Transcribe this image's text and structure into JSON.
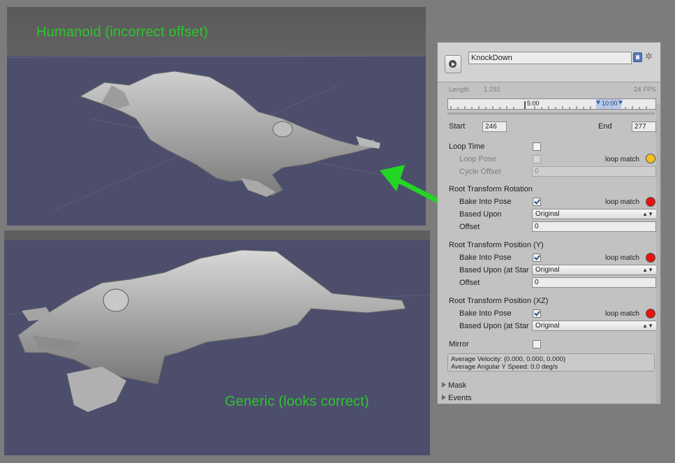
{
  "viewports": {
    "top_label": "Humanoid (incorrect offset)",
    "bottom_label": "Generic (looks correct)"
  },
  "colors": {
    "label_green": "#2ec52e",
    "sky_top": "#5a5a5a",
    "ground": "#4c4e6c",
    "match_yellow": "#f2c21a",
    "match_red": "#e8120e"
  },
  "inspector": {
    "clip_name": "KnockDown",
    "length_label": "Length",
    "length_value": "1.292",
    "fps": "24 FPS",
    "timeline_mark_1": "5:00",
    "timeline_mark_2": "10:00",
    "start_label": "Start",
    "start_value": "246",
    "end_label": "End",
    "end_value": "277",
    "loop_time_label": "Loop Time",
    "loop_time_checked": false,
    "loop_pose_label": "Loop Pose",
    "loop_pose_checked": false,
    "loop_match_label": "loop match",
    "cycle_offset_label": "Cycle Offset",
    "cycle_offset_value": "0",
    "rot": {
      "title": "Root Transform Rotation",
      "bake_label": "Bake Into Pose",
      "bake_checked": true,
      "based_label": "Based Upon",
      "based_value": "Original",
      "offset_label": "Offset",
      "offset_value": "0"
    },
    "posy": {
      "title": "Root Transform Position (Y)",
      "bake_label": "Bake Into Pose",
      "bake_checked": true,
      "based_label": "Based Upon (at Star",
      "based_value": "Original",
      "offset_label": "Offset",
      "offset_value": "0"
    },
    "posxz": {
      "title": "Root Transform Position (XZ)",
      "bake_label": "Bake Into Pose",
      "bake_checked": true,
      "based_label": "Based Upon (at Star",
      "based_value": "Original"
    },
    "mirror_label": "Mirror",
    "mirror_checked": false,
    "avg_velocity": "Average Velocity: (0.000, 0.000, 0.000)",
    "avg_angular": "Average Angular Y Speed: 0.0 deg/s",
    "mask_label": "Mask",
    "events_label": "Events"
  }
}
